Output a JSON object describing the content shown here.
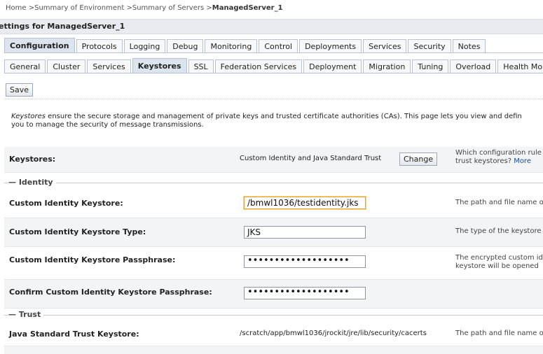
{
  "breadcrumb": {
    "items": [
      "Home",
      "Summary of Environment",
      "Summary of Servers"
    ],
    "separator": ">",
    "current": "ManagedServer_1"
  },
  "page_title": "ettings for ManagedServer_1",
  "tabs_primary": [
    {
      "label": "Configuration",
      "active": true
    },
    {
      "label": "Protocols",
      "active": false
    },
    {
      "label": "Logging",
      "active": false
    },
    {
      "label": "Debug",
      "active": false
    },
    {
      "label": "Monitoring",
      "active": false
    },
    {
      "label": "Control",
      "active": false
    },
    {
      "label": "Deployments",
      "active": false
    },
    {
      "label": "Services",
      "active": false
    },
    {
      "label": "Security",
      "active": false
    },
    {
      "label": "Notes",
      "active": false
    }
  ],
  "tabs_secondary": [
    {
      "label": "General",
      "active": false
    },
    {
      "label": "Cluster",
      "active": false
    },
    {
      "label": "Services",
      "active": false
    },
    {
      "label": "Keystores",
      "active": true
    },
    {
      "label": "SSL",
      "active": false
    },
    {
      "label": "Federation Services",
      "active": false
    },
    {
      "label": "Deployment",
      "active": false
    },
    {
      "label": "Migration",
      "active": false
    },
    {
      "label": "Tuning",
      "active": false
    },
    {
      "label": "Overload",
      "active": false
    },
    {
      "label": "Health Monitor",
      "active": false
    }
  ],
  "save_label": "Save",
  "description": {
    "emphasis": "Keystores",
    "text_line1": " ensure the secure storage and management of private keys and trusted certificate authorities (CAs). This page lets you view and defin",
    "text_line2": "you to manage the security of message transmissions."
  },
  "keystores_row": {
    "label": "Keystores:",
    "value": "Custom Identity and Java Standard Trust",
    "change_label": "Change",
    "help_line1": "Which configuration rule",
    "help_line2": "trust keystores?",
    "help_more": "More"
  },
  "section_identity": "Identity",
  "identity_rows": {
    "keystore": {
      "label": "Custom Identity Keystore:",
      "value": "/bmwl1036/testidentity.jks",
      "help": "The path and file name o"
    },
    "type": {
      "label": "Custom Identity Keystore Type:",
      "value": "JKS",
      "help": "The type of the keystore"
    },
    "passphrase": {
      "label": "Custom Identity Keystore Passphrase:",
      "value": "•••••••••••••••••••",
      "help_line1": "The encrypted custom id",
      "help_line2": "keystore will be opened"
    },
    "confirm": {
      "label": "Confirm Custom Identity Keystore Passphrase:",
      "value": "•••••••••••••••••••"
    }
  },
  "section_trust": "Trust",
  "trust_rows": {
    "java_standard": {
      "label": "Java Standard Trust Keystore:",
      "value": "/scratch/app/bmwl1036/jrockit/jre/lib/security/cacerts",
      "help": "The path and file name o"
    }
  }
}
